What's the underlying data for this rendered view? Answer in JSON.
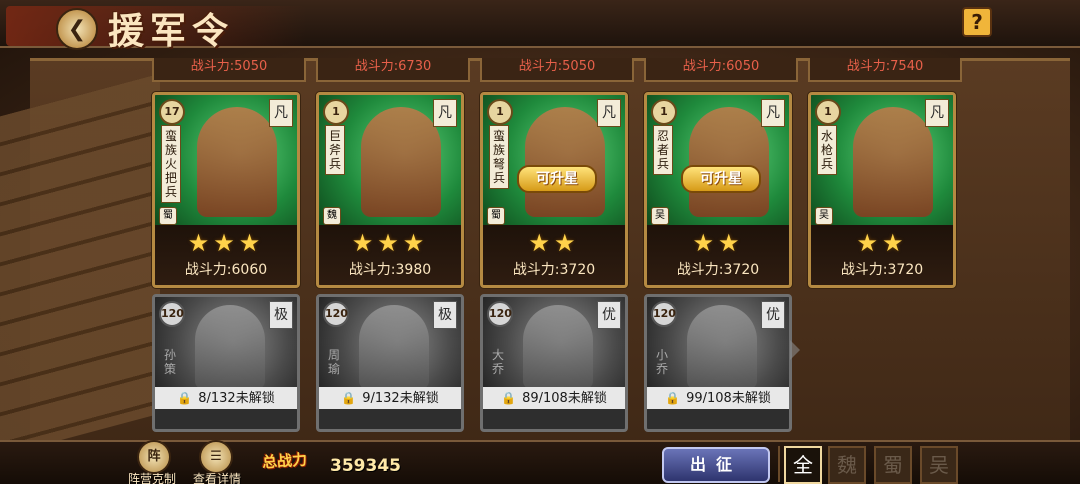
{
  "header": {
    "title": "援军令",
    "back_icon": "back-arrow-icon",
    "help_label": "?"
  },
  "prev_row_values": [
    "战斗力:5050",
    "战斗力:6730",
    "战斗力:5050",
    "战斗力:6050",
    "战斗力:7540"
  ],
  "unlocked_cards": [
    {
      "level": "17",
      "rank": "凡",
      "name": "蛮族火把兵",
      "faction": "蜀",
      "stars": "★★★",
      "power": "战斗力:6060",
      "upgrade": ""
    },
    {
      "level": "1",
      "rank": "凡",
      "name": "巨斧兵",
      "faction": "魏",
      "stars": "★★★",
      "power": "战斗力:3980",
      "upgrade": ""
    },
    {
      "level": "1",
      "rank": "凡",
      "name": "蛮族弩兵",
      "faction": "蜀",
      "stars": "★★",
      "power": "战斗力:3720",
      "upgrade": "可升星"
    },
    {
      "level": "1",
      "rank": "凡",
      "name": "忍者兵",
      "faction": "吴",
      "stars": "★★",
      "power": "战斗力:3720",
      "upgrade": "可升星"
    },
    {
      "level": "1",
      "rank": "凡",
      "name": "水枪兵",
      "faction": "吴",
      "stars": "★★",
      "power": "战斗力:3720",
      "upgrade": ""
    }
  ],
  "locked_cards": [
    {
      "level": "120",
      "rank": "极",
      "name": "孙策",
      "progress": "8/132未解锁"
    },
    {
      "level": "120",
      "rank": "极",
      "name": "周瑜",
      "progress": "9/132未解锁"
    },
    {
      "level": "120",
      "rank": "优",
      "name": "大乔",
      "progress": "89/108未解锁"
    },
    {
      "level": "120",
      "rank": "优",
      "name": "小乔",
      "progress": "99/108未解锁"
    }
  ],
  "bottom": {
    "formation_icon_text": "阵",
    "formation_label": "阵营克制",
    "details_label": "查看详情",
    "total_label": "总战力",
    "total_value": "359345",
    "go_label": "出征",
    "filters": [
      "全",
      "魏",
      "蜀",
      "吴"
    ]
  }
}
